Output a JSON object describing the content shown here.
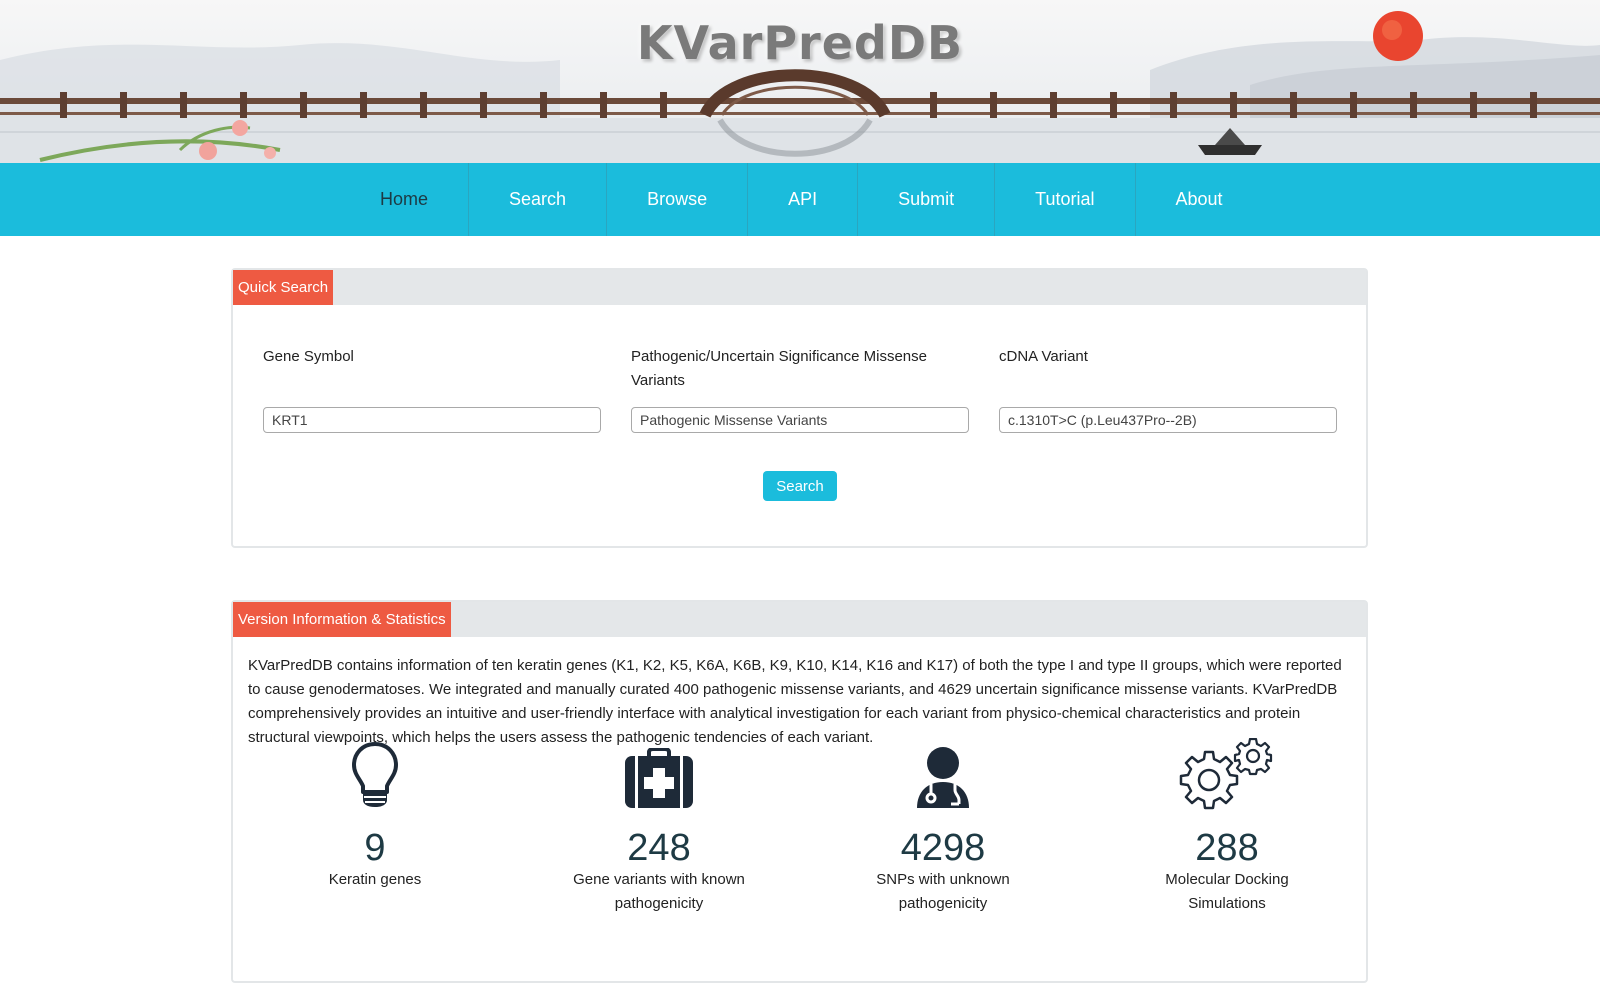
{
  "banner": {
    "title": "KVarPredDB"
  },
  "nav": {
    "items": [
      {
        "label": "Home",
        "active": true
      },
      {
        "label": "Search"
      },
      {
        "label": "Browse"
      },
      {
        "label": "API"
      },
      {
        "label": "Submit"
      },
      {
        "label": "Tutorial"
      },
      {
        "label": "About"
      }
    ]
  },
  "quick_search": {
    "title": "Quick Search",
    "fields": [
      {
        "label": "Gene Symbol",
        "value": "KRT1"
      },
      {
        "label": "Pathogenic/Uncertain Significance Missense Variants",
        "value": "Pathogenic Missense Variants"
      },
      {
        "label": "cDNA Variant",
        "value": "c.1310T>C (p.Leu437Pro--2B)"
      }
    ],
    "button_label": "Search"
  },
  "version_info": {
    "title": "Version Information & Statistics",
    "description": "KVarPredDB contains information of ten keratin genes (K1, K2, K5, K6A, K6B, K9, K10, K14, K16 and K17) of both the type I and type II groups, which were reported to cause genodermatoses. We integrated and manually curated 400 pathogenic missense variants, and 4629 uncertain significance missense variants. KVarPredDB comprehensively provides an intuitive and user-friendly interface with analytical investigation for each variant from physico-chemical characteristics and protein structural viewpoints, which helps the users assess the pathogenic tendencies of each variant.",
    "stats": [
      {
        "icon": "lightbulb-icon",
        "number": "9",
        "label": "Keratin genes"
      },
      {
        "icon": "medkit-icon",
        "number": "248",
        "label": "Gene variants with known pathogenicity"
      },
      {
        "icon": "doctor-icon",
        "number": "4298",
        "label": "SNPs with unknown pathogenicity"
      },
      {
        "icon": "gears-icon",
        "number": "288",
        "label": "Molecular Docking Simulations"
      }
    ]
  },
  "colors": {
    "nav_bg": "#1bbcdc",
    "tag_bg": "#ee5a42",
    "panel_head_bg": "#e4e7e9",
    "stat_number": "#1e3a44",
    "icon": "#1e2a38"
  }
}
